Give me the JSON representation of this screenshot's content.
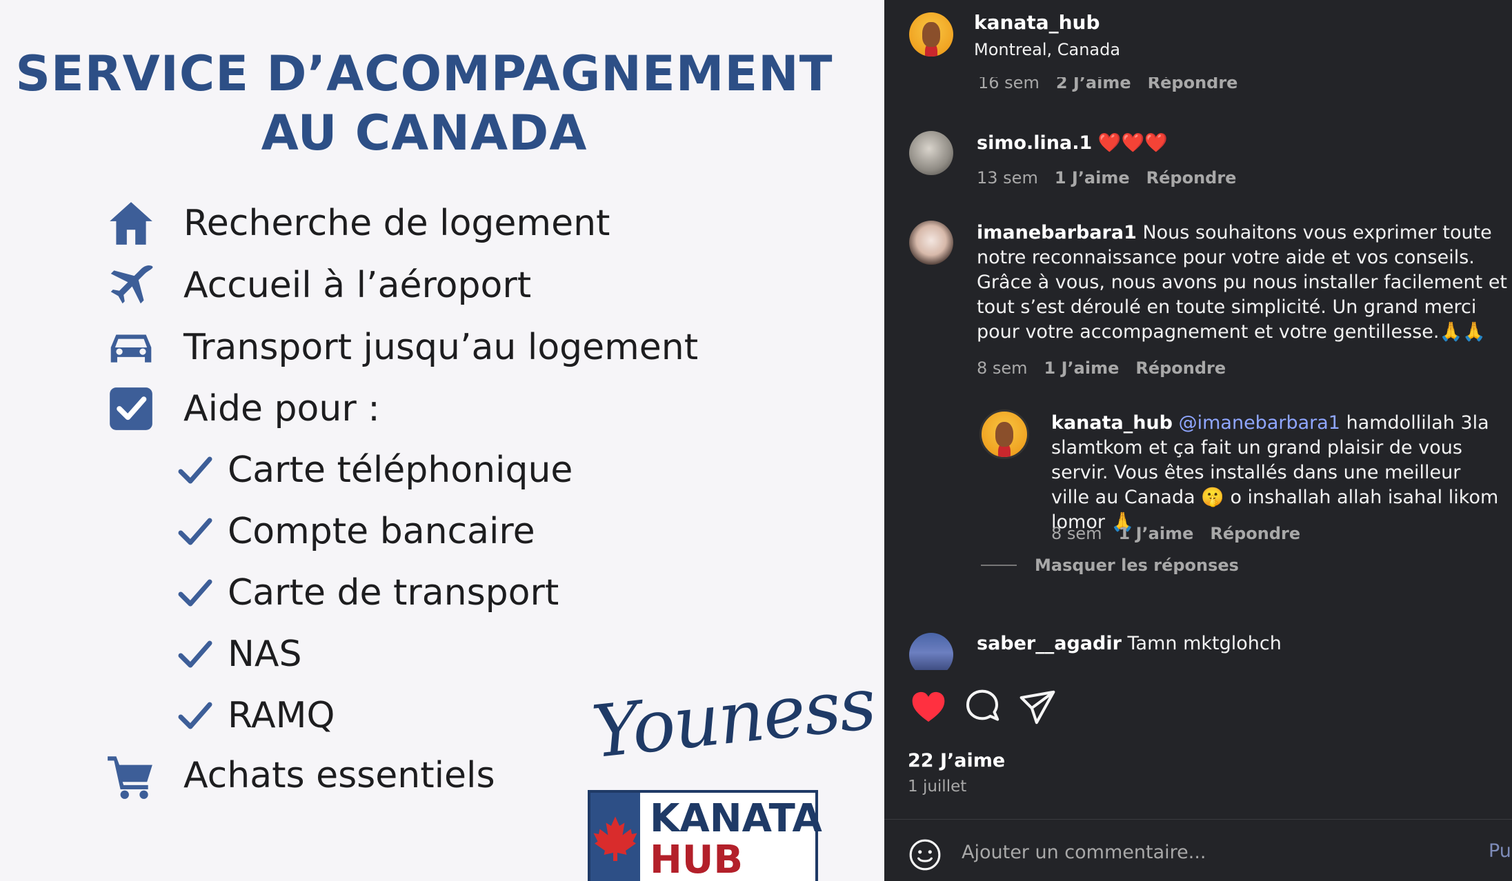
{
  "post": {
    "title_line1": "SERVICE D’ACOMPAGNEMENT",
    "title_line2": "AU CANADA",
    "services": [
      {
        "icon": "house-icon",
        "label": "Recherche de logement"
      },
      {
        "icon": "airplane-icon",
        "label": "Accueil à l’aéroport"
      },
      {
        "icon": "car-icon",
        "label": "Transport jusqu’au logement"
      },
      {
        "icon": "checkbox-icon",
        "label": "Aide pour :"
      },
      {
        "icon": "cart-icon",
        "label": "Achats essentiels"
      }
    ],
    "sub_items": [
      "Carte téléphonique",
      "Compte bancaire",
      "Carte de transport",
      "NAS",
      "RAMQ"
    ],
    "signature": "Youness",
    "logo_line1": "KANATA",
    "logo_line2": "HUB",
    "colors": {
      "title": "#2d4f86",
      "icons": "#3d5e98",
      "background": "#f6f5f8",
      "logo_red": "#b3202a"
    }
  },
  "header": {
    "username": "kanata_hub",
    "location": "Montreal, Canada"
  },
  "comments": [
    {
      "partial_meta": {
        "time": "16 sem",
        "likes": "2 J’aime",
        "reply": "Répondre"
      }
    },
    {
      "username": "simo.lina.1",
      "text": "❤️❤️❤️",
      "time": "13 sem",
      "likes": "1 J’aime",
      "reply": "Répondre"
    },
    {
      "username": "imanebarbara1",
      "text": "Nous souhaitons vous exprimer toute notre reconnaissance pour votre aide et vos conseils. Grâce à vous, nous avons pu nous installer facilement et tout s’est déroulé en toute simplicité. Un grand merci pour votre accompagnement et votre gentillesse.🙏🙏",
      "time": "8 sem",
      "likes": "1 J’aime",
      "reply": "Répondre"
    },
    {
      "username": "kanata_hub",
      "mention": "@imanebarbara1",
      "text": "hamdollilah 3la slamtkom et ça fait un grand plaisir de vous servir. Vous êtes installés dans une meilleur ville au Canada 🤫 o inshallah allah isahal likom lomor 🙏",
      "time": "8 sem",
      "likes": "1 J’aime",
      "reply": "Répondre"
    },
    {
      "username": "saber__agadir",
      "text": "Tamn mktglohch"
    }
  ],
  "hide_replies": "Masquer les réponses",
  "actions": {
    "like_icon": "heart-icon",
    "comment_icon": "comment-icon",
    "share_icon": "send-icon",
    "likes_count": "22 J’aime",
    "date": "1 juillet",
    "colors": {
      "liked": "#ff3040"
    }
  },
  "add_comment": {
    "placeholder": "Ajouter un commentaire...",
    "post_label": "Pu"
  }
}
